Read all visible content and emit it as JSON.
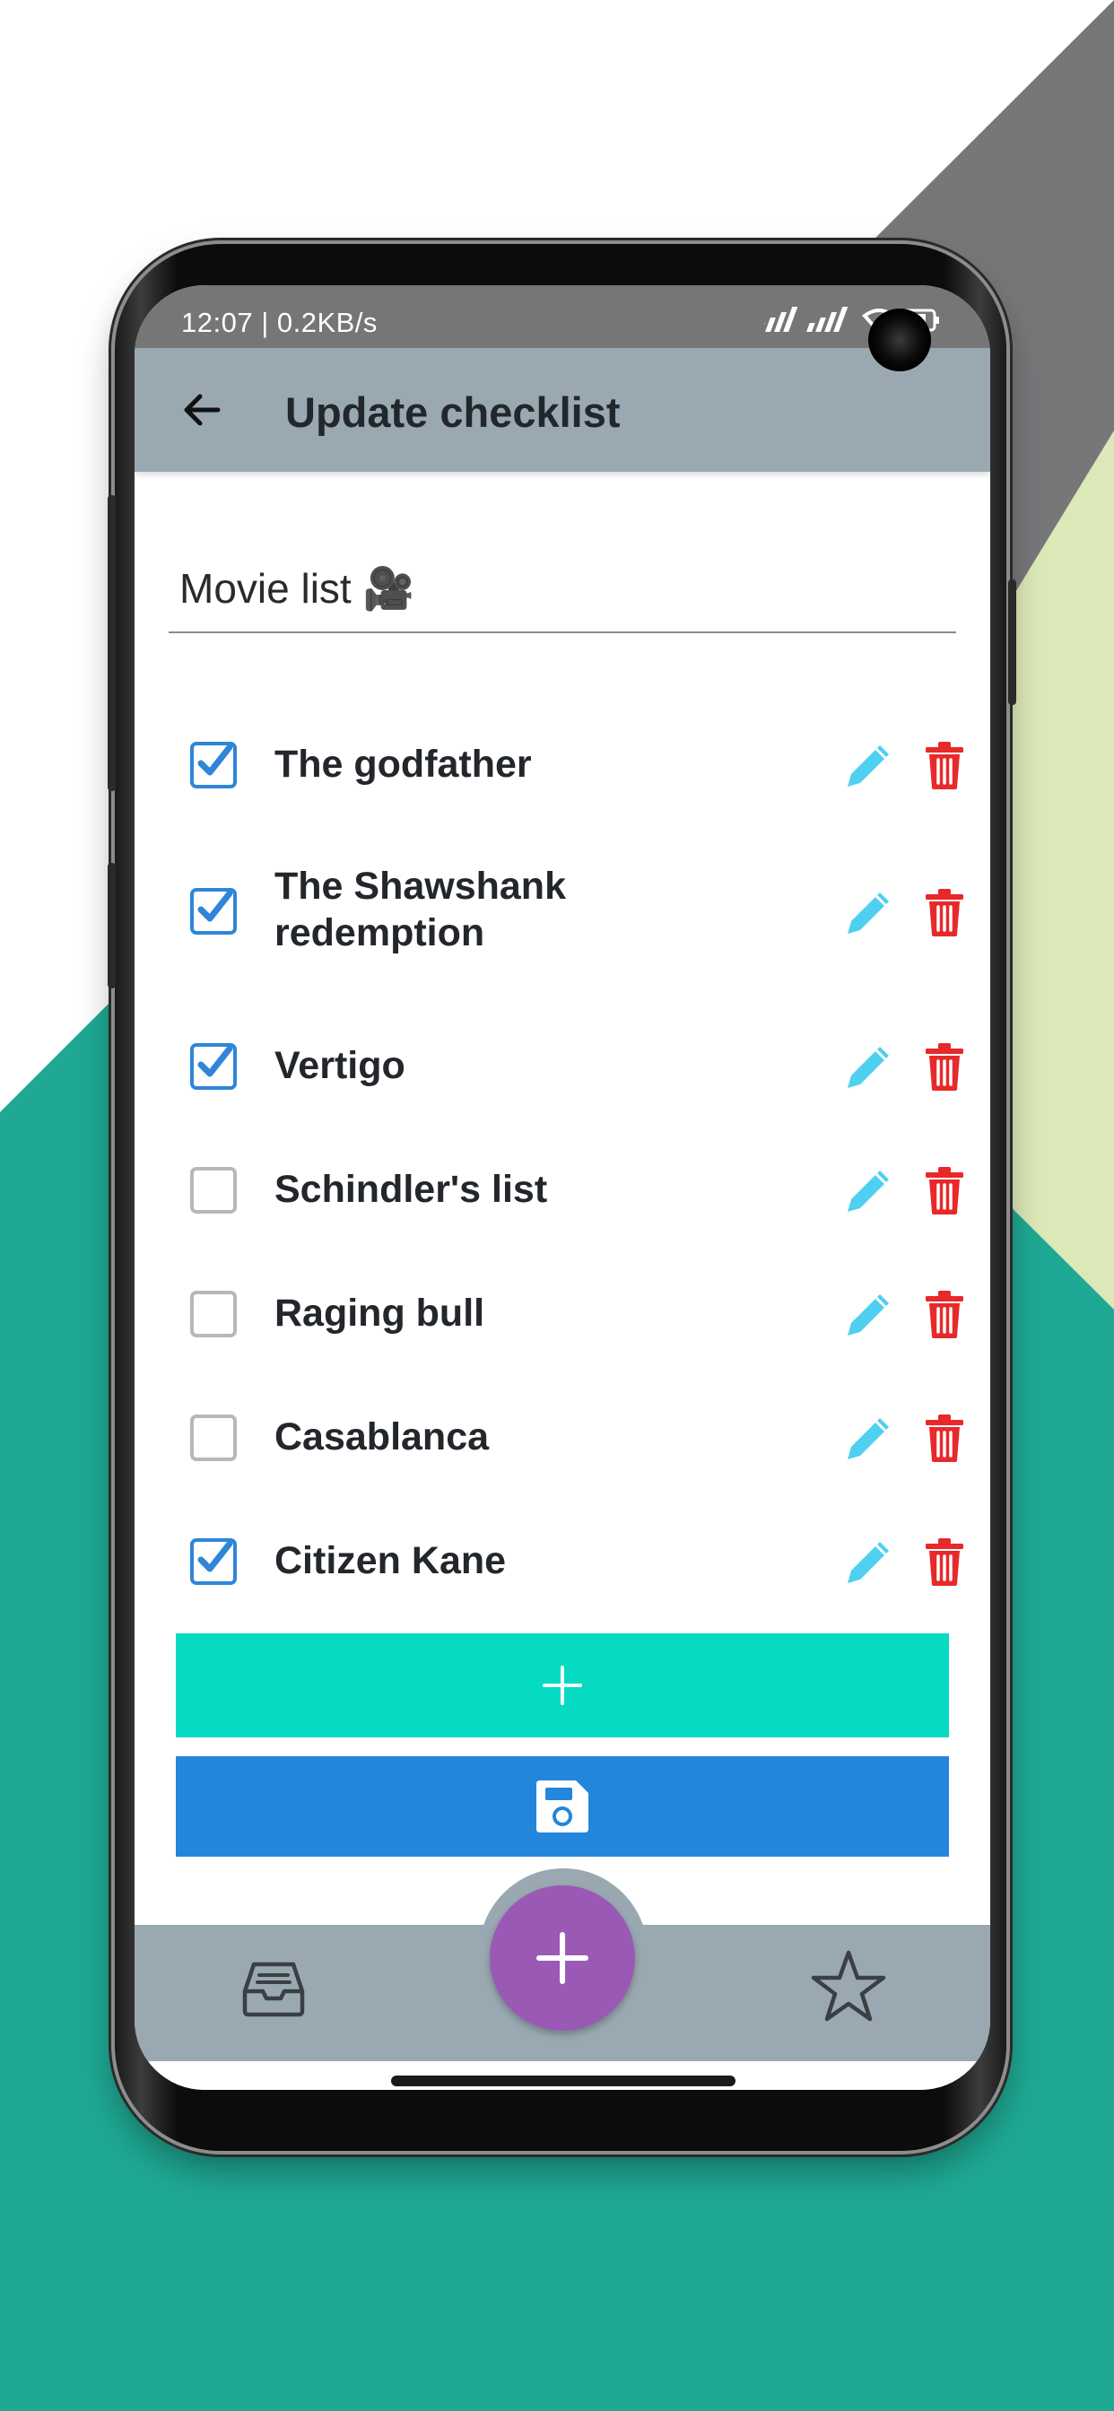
{
  "status_bar": {
    "text": "12:07 | 0.2KB/s"
  },
  "app_bar": {
    "title": "Update checklist",
    "back_icon": "arrow-left-icon"
  },
  "checklist": {
    "title_value": "Movie list 🎥",
    "items": [
      {
        "label": "The godfather",
        "checked": true
      },
      {
        "label": "The Shawshank redemption",
        "checked": true
      },
      {
        "label": "Vertigo",
        "checked": true
      },
      {
        "label": "Schindler's list",
        "checked": false
      },
      {
        "label": "Raging bull",
        "checked": false
      },
      {
        "label": "Casablanca",
        "checked": false
      },
      {
        "label": "Citizen Kane",
        "checked": true
      }
    ]
  },
  "buttons": {
    "add_icon": "plus-icon",
    "save_icon": "save-icon"
  },
  "bottom_nav": {
    "left_icon": "inbox-icon",
    "fab_icon": "plus-icon",
    "right_icon": "star-icon"
  },
  "colors": {
    "app_bar": "#9aa8b1",
    "status_bar": "#777676",
    "check_blue": "#2f86d8",
    "edit_cyan": "#4fd0f0",
    "delete_red": "#e8292a",
    "add_button": "#05dac3",
    "save_button": "#2287db",
    "fab": "#9b59b6",
    "bg_teal": "#1fa893",
    "bg_gray": "#777679",
    "bg_lime": "#dbe8b8"
  }
}
